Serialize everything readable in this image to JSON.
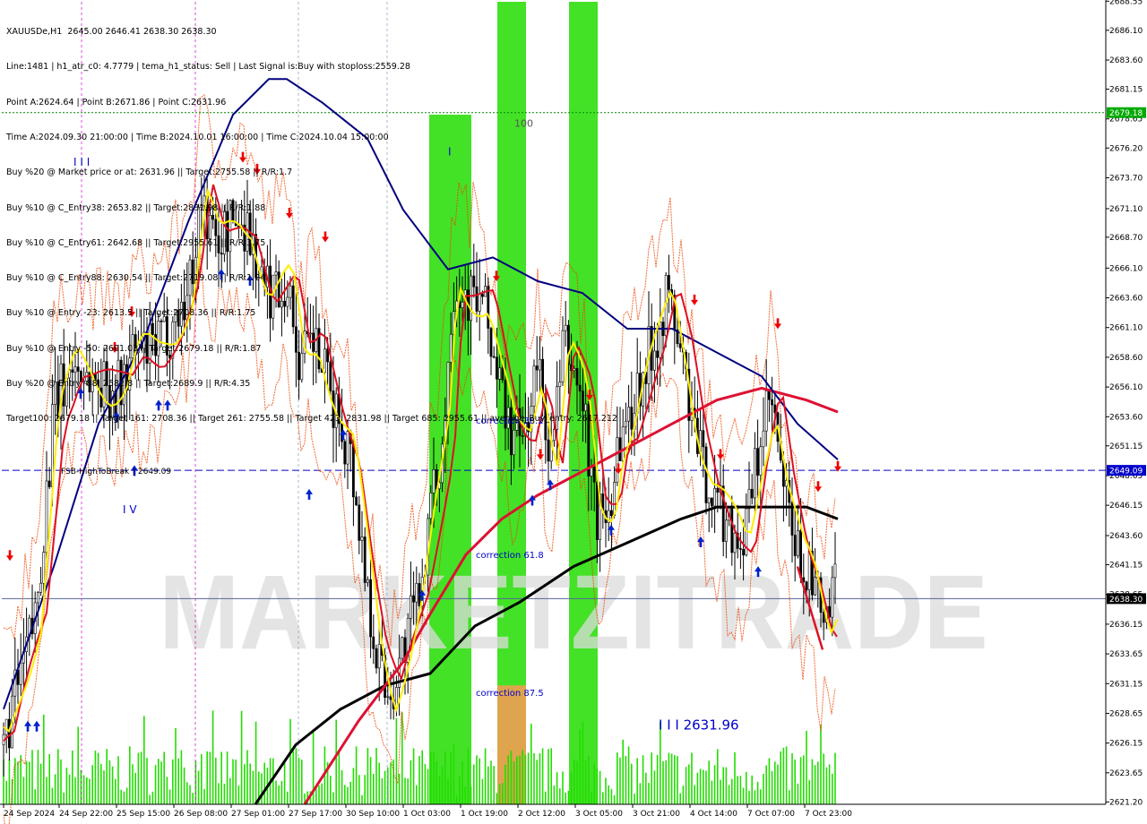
{
  "header": {
    "lines": [
      "XAUUSDe,H1  2645.00 2646.41 2638.30 2638.30",
      "Line:1481 | h1_atr_c0: 4.7779 | tema_h1_status: Sell | Last Signal is:Buy with stoploss:2559.28",
      "Point A:2624.64 | Point B:2671.86 | Point C:2631.96",
      "Time A:2024.09.30 21:00:00 | Time B:2024.10.01 16:00:00 | Time C:2024.10.04 15:00:00",
      "Buy %20 @ Market price or at: 2631.96 || Target:2755.58 || R/R:1.7",
      "Buy %10 @ C_Entry38: 2653.82 || Target:2831.98 || R/R:1.88",
      "Buy %10 @ C_Entry61: 2642.68 || Target:2955.61 || R/R:3.75",
      "Buy %10 @ C_Entry88: 2630.54 || Target:2719.08 || R/R:1.24",
      "Buy %10 @ Entry -23: 2613.5 || Target:2708.36 || R/R:1.75",
      "Buy %10 @ Entry -50: 2601.03 || Target:2679.18 || R/R:1.87",
      "Buy %20 @ Entry -88: 2582.8 || Target:2689.9 || R/R:4.35",
      "Target100: 2679.18 || Target 161: 2708.36 || Target 261: 2755.58 || Target 423: 2831.98 || Target 685: 2955.61 || average_Buy_entry: 2617.212"
    ]
  },
  "watermark": "MARKETZITRADE",
  "colors": {
    "candle": "#000000",
    "green_zone": "#22dd00",
    "orange_zone": "#e8a050",
    "ma_black": "#000000",
    "ma_red": "#dd1133",
    "ma_navy": "#00007f",
    "ma_yellow": "#ffee00",
    "channel": "#ee4400",
    "volume": "#22dd00",
    "buy_arrow": "#0022cc",
    "sell_arrow": "#ee0000"
  },
  "chart_data": {
    "type": "candlestick",
    "symbol": "XAUUSDe",
    "timeframe": "H1",
    "ylim": [
      2621.0,
      2688.5
    ],
    "y_ticks": [
      2688.55,
      2686.1,
      2683.6,
      2681.15,
      2678.65,
      2676.2,
      2673.7,
      2671.1,
      2668.7,
      2666.1,
      2663.6,
      2661.1,
      2658.6,
      2656.1,
      2653.6,
      2651.15,
      2648.65,
      2646.15,
      2643.6,
      2641.15,
      2638.65,
      2636.15,
      2633.65,
      2631.15,
      2628.65,
      2626.15,
      2623.65,
      2621.2
    ],
    "x_ticks": [
      "24 Sep 2024",
      "24 Sep 22:00",
      "25 Sep 15:00",
      "26 Sep 08:00",
      "27 Sep 01:00",
      "27 Sep 17:00",
      "30 Sep 10:00",
      "1 Oct 03:00",
      "1 Oct 19:00",
      "2 Oct 12:00",
      "3 Oct 05:00",
      "3 Oct 21:00",
      "4 Oct 14:00",
      "7 Oct 07:00",
      "7 Oct 23:00"
    ],
    "horizontal_lines": [
      {
        "label": "2679.18",
        "value": 2679.18,
        "style": "dotted",
        "color": "#008800"
      },
      {
        "label": "2649.09",
        "value": 2649.09,
        "style": "dashed",
        "color": "#0000cc"
      },
      {
        "label": "2638.30",
        "value": 2638.3,
        "style": "solid",
        "color": "#556699"
      }
    ],
    "annotations": [
      {
        "text": "FSB-HighToBreak",
        "value": 2649.09
      },
      {
        "text": "| 2649.09",
        "value": 2649.09
      },
      {
        "text": "100",
        "value": 2678.3
      },
      {
        "text": "I I I",
        "value": 2675.0
      },
      {
        "text": "I",
        "value": 2675.9
      },
      {
        "text": "I V",
        "value": 2645.8
      },
      {
        "text": "correction 38.2",
        "value": 2653.3
      },
      {
        "text": "correction 61.8",
        "value": 2642.0
      },
      {
        "text": "correction 87.5",
        "value": 2630.4
      },
      {
        "text": "I I I 2631.96",
        "value": 2627.6
      }
    ],
    "last_price": 2638.3,
    "legend": "none",
    "grid": false
  }
}
